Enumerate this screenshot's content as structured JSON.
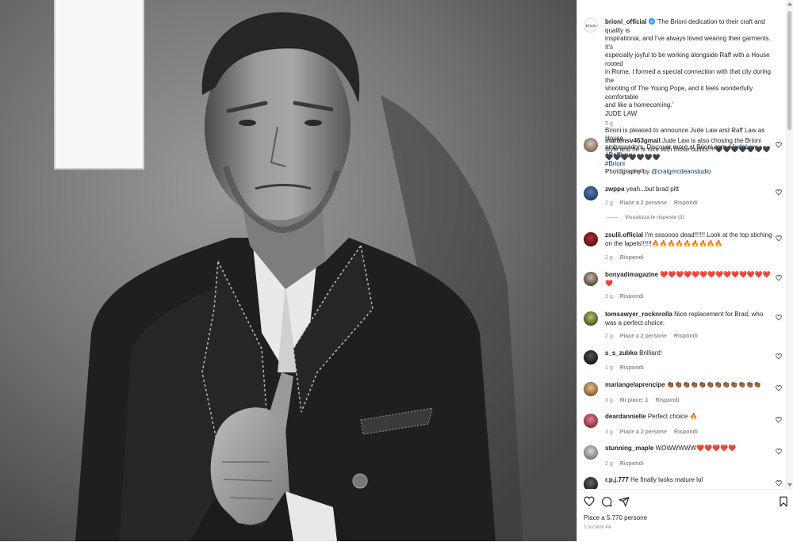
{
  "post": {
    "author": "brioni_official",
    "caption_lines": [
      "'The Brioni dedication to their craft and quality is",
      "inspirational, and I've always loved wearing their garments. It's",
      "especially joyful to be working alongside Raff with a House rooted",
      "in Rome. I formed a special connection with that city during the",
      "shooting of The Young Pope, and it feels wonderfully comfortable",
      "and like a homecoming.'",
      "JUDE LAW",
      "-",
      "Brioni is pleased to announce Jude Law and Raff Law as House",
      "ambassadors. Discover more at Brioni.com"
    ],
    "hashtags": [
      "#JudeLaw",
      "#RaffLaw",
      "#Brioni"
    ],
    "photo_credit_label": "Photography by",
    "photo_credit_handle": "@craigmcdeanstudio",
    "caption_age": "3 g",
    "likes": "Piace a 5.770 persone",
    "date": "3 GIORNI FA"
  },
  "comments": [
    {
      "user": "martensv463gmail",
      "text": "Jude Law is also chosing the Brioni style and he is nice with those outfits!!!!🖤🖤🖤🖤🖤🖤🖤🖤🖤🖤🖤🖤🖤🖤",
      "age": "1 g",
      "likes": "",
      "reply": "Rispondi"
    },
    {
      "user": "zwppa",
      "text": "yeah...but brad pitt",
      "age": "2 g",
      "likes": "Piace a 2 persone",
      "reply": "Rispondi"
    },
    {
      "user": "zsulli.official",
      "text": "I'm sssoooo dead!!!!!! Look at the top stiching on the lapels!!!!!!🔥🔥🔥🔥🔥🔥🔥🔥🔥",
      "age": "2 g",
      "likes": "",
      "reply": "Rispondi"
    },
    {
      "user": "bonyadimagazine",
      "text": "❤️❤️❤️❤️❤️❤️❤️❤️❤️❤️❤️❤️❤️❤️❤️",
      "age": "3 g",
      "likes": "",
      "reply": "Rispondi"
    },
    {
      "user": "tomsawyer_rocknrolla",
      "text": "Nice replacement for Brad, who was a perfect choice.",
      "age": "2 g",
      "likes": "Piace a 2 persone",
      "reply": "Rispondi"
    },
    {
      "user": "s_s_zubko",
      "text": "Brilliant!",
      "age": "1 g",
      "likes": "",
      "reply": "Rispondi"
    },
    {
      "user": "mariangelaprencipe",
      "text": "👏🏾👏🏾👏🏾👏🏾👏🏾👏🏾👏🏾👏🏾👏🏾👏🏾👏🏾👏🏾",
      "age": "3 g",
      "likes": "Mi piace: 1",
      "reply": "Rispondi"
    },
    {
      "user": "deardannielle",
      "text": "Perfect choice 🔥",
      "age": "3 g",
      "likes": "Piace a 2 persone",
      "reply": "Rispondi"
    },
    {
      "user": "stunning_maple",
      "text": "WOWWWWW❤️❤️❤️❤️❤️",
      "age": "2 g",
      "likes": "",
      "reply": "Rispondi"
    },
    {
      "user": "r.p.j.777",
      "text": "He finally looks mature lol",
      "age": "",
      "likes": "",
      "reply": ""
    }
  ],
  "view_replies": "Visualizza le risposte (1)",
  "colors": {
    "link": "#00376b",
    "verified": "#3897f0",
    "heart": "#ed4956",
    "meta": "#8e8e8e"
  },
  "icons": [
    "heart-icon",
    "comment-icon",
    "share-icon",
    "bookmark-icon",
    "verified-badge-icon"
  ]
}
